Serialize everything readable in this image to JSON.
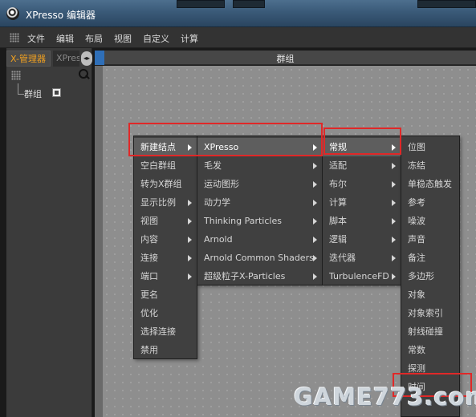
{
  "window": {
    "title": "XPresso 编辑器"
  },
  "menubar": {
    "items": [
      "文件",
      "编辑",
      "布局",
      "视图",
      "自定义",
      "计算"
    ]
  },
  "left_panel": {
    "tabs": [
      "X-管理器",
      "XPresso"
    ],
    "tree_item": "群组"
  },
  "main": {
    "title": "群组"
  },
  "context_menu": {
    "items": [
      "新建结点",
      "空白群组",
      "转为X群组",
      "显示比例",
      "视图",
      "内容",
      "连接",
      "端口",
      "更名",
      "优化",
      "选择连接",
      "禁用"
    ]
  },
  "submenu_new_node": {
    "items": [
      "XPresso",
      "毛发",
      "运动图形",
      "动力学",
      "Thinking Particles",
      "Arnold",
      "Arnold Common Shaders",
      "超级粒子X-Particles"
    ]
  },
  "submenu_xpresso": {
    "items": [
      "常规",
      "适配",
      "布尔",
      "计算",
      "脚本",
      "逻辑",
      "迭代器",
      "TurbulenceFD"
    ]
  },
  "submenu_general": {
    "items": [
      "位图",
      "冻结",
      "单稳态触发",
      "参考",
      "噪波",
      "声音",
      "备注",
      "多边形",
      "对象",
      "对象索引",
      "射线碰撞",
      "常数",
      "探测",
      "时间"
    ]
  },
  "watermark": "GAME773.com"
}
